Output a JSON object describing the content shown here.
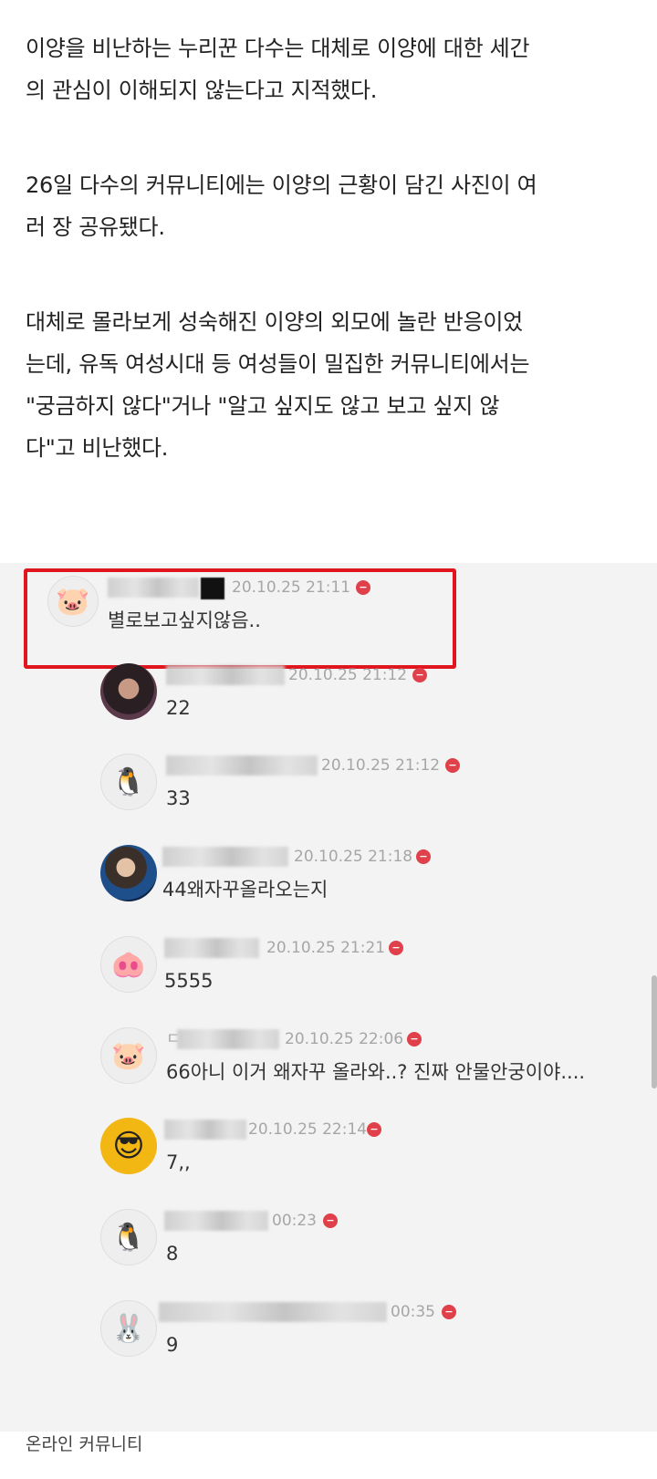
{
  "article": {
    "paragraphs": [
      [
        "이양을 비난하는 누리꾼 다수는 대체로 이양에 대한 세간",
        "의 관심이 이해되지 않는다고 지적했다."
      ],
      [
        "26일 다수의 커뮤니티에는 이양의 근황이 담긴 사진이 여",
        "러 장 공유됐다."
      ],
      [
        "대체로 몰라보게 성숙해진 이양의 외모에 놀란 반응이었",
        "는데, 유독 여성시대 등 여성들이 밀집한 커뮤니티에서는",
        "\"궁금하지 않다\"거나 \"알고 싶지도 않고 보고 싶지 않",
        "다\"고 비난했다."
      ]
    ]
  },
  "comments": [
    {
      "avatar": "pig-icon",
      "timestamp": "20.10.25 21:11",
      "text": "별로보고싶지않음..",
      "highlighted": true
    },
    {
      "avatar": "profile-photo",
      "timestamp": "20.10.25 21:12",
      "text": "22"
    },
    {
      "avatar": "penguin-icon",
      "timestamp": "20.10.25 21:12",
      "text": "33"
    },
    {
      "avatar": "profile-photo",
      "timestamp": "20.10.25 21:18",
      "text": "44왜자꾸올라오는지"
    },
    {
      "avatar": "piglet-icon",
      "timestamp": "20.10.25 21:21",
      "text": "5555"
    },
    {
      "avatar": "pig-icon",
      "timestamp": "20.10.25 22:06",
      "text": "66아니 이거 왜자꾸 올라와..? 진짜 안물안궁이야....",
      "name_prefix": "ㄷ"
    },
    {
      "avatar": "sunglasses-face-icon",
      "timestamp": "20.10.25 22:14",
      "text": "7,,"
    },
    {
      "avatar": "penguin-icon",
      "timestamp": "00:23",
      "text": "8"
    },
    {
      "avatar": "rabbit-icon",
      "timestamp": "00:35",
      "text": "9"
    }
  ],
  "source": "온라인 커뮤니티",
  "colors": {
    "highlight": "#e0151e",
    "delete_icon": "#e0404a",
    "timestamp": "#a6a6a6"
  }
}
